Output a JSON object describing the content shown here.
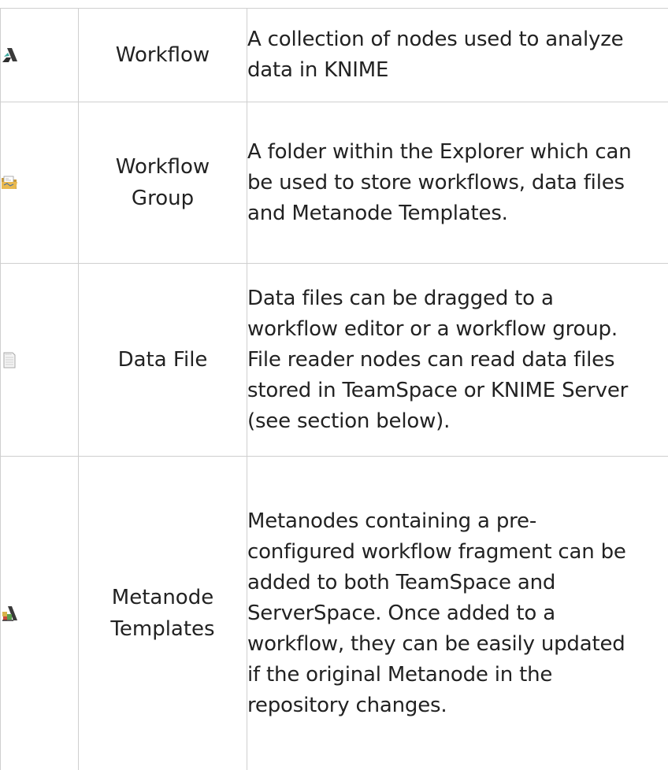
{
  "rows": [
    {
      "icon": "workflow-icon",
      "name": "Workflow",
      "description": "A collection of nodes used to analyze data in KNIME"
    },
    {
      "icon": "workflow-group-folder-icon",
      "name": "Workflow Group",
      "description": "A folder within the Explorer which can be used to store workflows, data files and Metanode Templates."
    },
    {
      "icon": "data-file-icon",
      "name": "Data File",
      "description": "Data files can be dragged to a workflow editor or a workflow group. File reader nodes can read data files stored in TeamSpace or KNIME Server (see section below)."
    },
    {
      "icon": "metanode-template-icon",
      "name": "Metanode Templates",
      "description": "Metanodes containing a pre-configured workflow fragment can be added to both TeamSpace and ServerSpace. Once added to a workflow, they can be easily updated if the original Metanode in the repository changes."
    }
  ]
}
